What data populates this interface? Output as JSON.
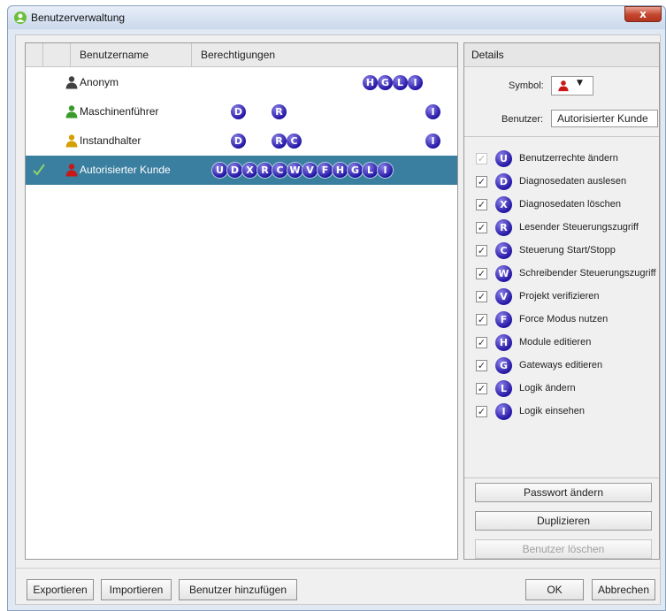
{
  "window": {
    "title": "Benutzerverwaltung",
    "close_label": "x"
  },
  "list": {
    "headers": [
      "Benutzername",
      "Berechtigungen"
    ],
    "users": [
      {
        "name": "Anonym",
        "icon_color": "#404040",
        "selected": false,
        "permissions": [
          "H",
          "G",
          "L",
          "I"
        ]
      },
      {
        "name": "Maschinenführer",
        "icon_color": "#3a9a2a",
        "selected": false,
        "permissions": [
          "D",
          "R",
          "I"
        ]
      },
      {
        "name": "Instandhalter",
        "icon_color": "#d4a000",
        "selected": false,
        "permissions": [
          "D",
          "R",
          "C",
          "I"
        ]
      },
      {
        "name": "Autorisierter Kunde",
        "icon_color": "#c81818",
        "selected": true,
        "permissions": [
          "U",
          "D",
          "X",
          "R",
          "C",
          "W",
          "V",
          "F",
          "H",
          "G",
          "L",
          "I"
        ]
      }
    ]
  },
  "details": {
    "title": "Details",
    "symbol_label": "Symbol:",
    "symbol_color": "#c81818",
    "user_label": "Benutzer:",
    "user_value": "Autorisierter Kunde",
    "permissions": [
      {
        "letter": "U",
        "label": "Benutzerrechte ändern",
        "checked": true,
        "enabled": false
      },
      {
        "letter": "D",
        "label": "Diagnosedaten auslesen",
        "checked": true,
        "enabled": true
      },
      {
        "letter": "X",
        "label": "Diagnosedaten löschen",
        "checked": true,
        "enabled": true
      },
      {
        "letter": "R",
        "label": "Lesender Steuerungszugriff",
        "checked": true,
        "enabled": true
      },
      {
        "letter": "C",
        "label": "Steuerung Start/Stopp",
        "checked": true,
        "enabled": true
      },
      {
        "letter": "W",
        "label": "Schreibender Steuerungszugriff",
        "checked": true,
        "enabled": true
      },
      {
        "letter": "V",
        "label": "Projekt verifizieren",
        "checked": true,
        "enabled": true
      },
      {
        "letter": "F",
        "label": "Force Modus nutzen",
        "checked": true,
        "enabled": true
      },
      {
        "letter": "H",
        "label": "Module editieren",
        "checked": true,
        "enabled": true
      },
      {
        "letter": "G",
        "label": "Gateways editieren",
        "checked": true,
        "enabled": true
      },
      {
        "letter": "L",
        "label": "Logik ändern",
        "checked": true,
        "enabled": true
      },
      {
        "letter": "I",
        "label": "Logik einsehen",
        "checked": true,
        "enabled": true
      }
    ],
    "buttons": {
      "change_password": "Passwort ändern",
      "duplicate": "Duplizieren",
      "delete_user": "Benutzer löschen"
    }
  },
  "footer": {
    "export": "Exportieren",
    "import": "Importieren",
    "add_user": "Benutzer hinzufügen",
    "ok": "OK",
    "cancel": "Abbrechen"
  }
}
